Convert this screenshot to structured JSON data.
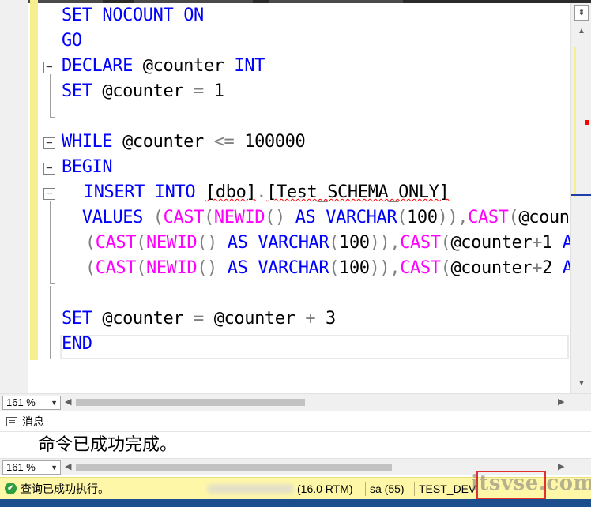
{
  "editor": {
    "lines": [
      [
        {
          "t": "SET",
          "c": "kw"
        },
        {
          "t": " "
        },
        {
          "t": "NOCOUNT",
          "c": "kw"
        },
        {
          "t": " "
        },
        {
          "t": "ON",
          "c": "kw"
        }
      ],
      [
        {
          "t": "GO",
          "c": "kw"
        }
      ],
      [
        {
          "t": "DECLARE",
          "c": "kw"
        },
        {
          "t": " @counter ",
          "c": "var"
        },
        {
          "t": "INT",
          "c": "kw"
        }
      ],
      [
        {
          "t": "SET",
          "c": "kw"
        },
        {
          "t": " @counter ",
          "c": "var"
        },
        {
          "t": "=",
          "c": "op"
        },
        {
          "t": " 1",
          "c": "num"
        }
      ],
      [],
      [
        {
          "t": "WHILE",
          "c": "kw"
        },
        {
          "t": " @counter ",
          "c": "var"
        },
        {
          "t": "<=",
          "c": "op"
        },
        {
          "t": " 100000",
          "c": "num"
        }
      ],
      [
        {
          "t": "BEGIN",
          "c": "kw"
        }
      ],
      [
        {
          "t": " "
        },
        {
          "t": "INSERT",
          "c": "kw"
        },
        {
          "t": " "
        },
        {
          "t": "INTO",
          "c": "kw"
        },
        {
          "t": " "
        },
        {
          "t": "[dbo]",
          "c": "obj",
          "s": true
        },
        {
          "t": ".",
          "c": "op"
        },
        {
          "t": "[Test_SCHEMA_ONLY]",
          "c": "obj",
          "s": true
        }
      ],
      [
        {
          "t": " "
        },
        {
          "t": "VALUES",
          "c": "kw"
        },
        {
          "t": " "
        },
        {
          "t": "(",
          "c": "op"
        },
        {
          "t": "CAST",
          "c": "fn"
        },
        {
          "t": "(",
          "c": "op"
        },
        {
          "t": "NEWID",
          "c": "fn"
        },
        {
          "t": "()",
          "c": "op"
        },
        {
          "t": " "
        },
        {
          "t": "AS",
          "c": "kw"
        },
        {
          "t": " "
        },
        {
          "t": "VARCHAR",
          "c": "kw"
        },
        {
          "t": "(",
          "c": "op"
        },
        {
          "t": "100",
          "c": "num"
        },
        {
          "t": ")),",
          "c": "op"
        },
        {
          "t": "CAST",
          "c": "fn"
        },
        {
          "t": "(",
          "c": "op"
        },
        {
          "t": "@counter",
          "c": "var"
        }
      ],
      [
        {
          "t": " "
        },
        {
          "t": "(",
          "c": "op"
        },
        {
          "t": "CAST",
          "c": "fn"
        },
        {
          "t": "(",
          "c": "op"
        },
        {
          "t": "NEWID",
          "c": "fn"
        },
        {
          "t": "()",
          "c": "op"
        },
        {
          "t": " "
        },
        {
          "t": "AS",
          "c": "kw"
        },
        {
          "t": " "
        },
        {
          "t": "VARCHAR",
          "c": "kw"
        },
        {
          "t": "(",
          "c": "op"
        },
        {
          "t": "100",
          "c": "num"
        },
        {
          "t": ")),",
          "c": "op"
        },
        {
          "t": "CAST",
          "c": "fn"
        },
        {
          "t": "(",
          "c": "op"
        },
        {
          "t": "@counter",
          "c": "var"
        },
        {
          "t": "+",
          "c": "op"
        },
        {
          "t": "1 ",
          "c": "num"
        },
        {
          "t": "AS",
          "c": "kw"
        }
      ],
      [
        {
          "t": " "
        },
        {
          "t": "(",
          "c": "op"
        },
        {
          "t": "CAST",
          "c": "fn"
        },
        {
          "t": "(",
          "c": "op"
        },
        {
          "t": "NEWID",
          "c": "fn"
        },
        {
          "t": "()",
          "c": "op"
        },
        {
          "t": " "
        },
        {
          "t": "AS",
          "c": "kw"
        },
        {
          "t": " "
        },
        {
          "t": "VARCHAR",
          "c": "kw"
        },
        {
          "t": "(",
          "c": "op"
        },
        {
          "t": "100",
          "c": "num"
        },
        {
          "t": ")),",
          "c": "op"
        },
        {
          "t": "CAST",
          "c": "fn"
        },
        {
          "t": "(",
          "c": "op"
        },
        {
          "t": "@counter",
          "c": "var"
        },
        {
          "t": "+",
          "c": "op"
        },
        {
          "t": "2 ",
          "c": "num"
        },
        {
          "t": "AS",
          "c": "kw"
        }
      ],
      [],
      [
        {
          "t": "SET",
          "c": "kw"
        },
        {
          "t": " @counter ",
          "c": "var"
        },
        {
          "t": "=",
          "c": "op"
        },
        {
          "t": " @counter ",
          "c": "var"
        },
        {
          "t": "+",
          "c": "op"
        },
        {
          "t": " 3",
          "c": "num"
        }
      ],
      [
        {
          "t": "END",
          "c": "kw"
        }
      ]
    ],
    "fold_markers": [
      "−",
      "−",
      "−",
      "−"
    ],
    "zoom_value": "161 %",
    "scroll_top_label": "⇟"
  },
  "messages": {
    "tab_label": "消息",
    "tab_icon": "messages-icon",
    "text": "命令已成功完成。",
    "zoom_value": "161 %"
  },
  "status_bar": {
    "status_icon": "check-circle-icon",
    "status_text": "查询已成功执行。",
    "version": "(16.0 RTM)",
    "user": "sa (55)",
    "database": "TEST_DEV",
    "watermark": "itsvse.com"
  },
  "colors": {
    "keyword": "#0000ff",
    "function": "#ff00ff",
    "operator": "#808080",
    "status_bar_bg": "#fff7a8",
    "highlight_box": "#e03030"
  }
}
